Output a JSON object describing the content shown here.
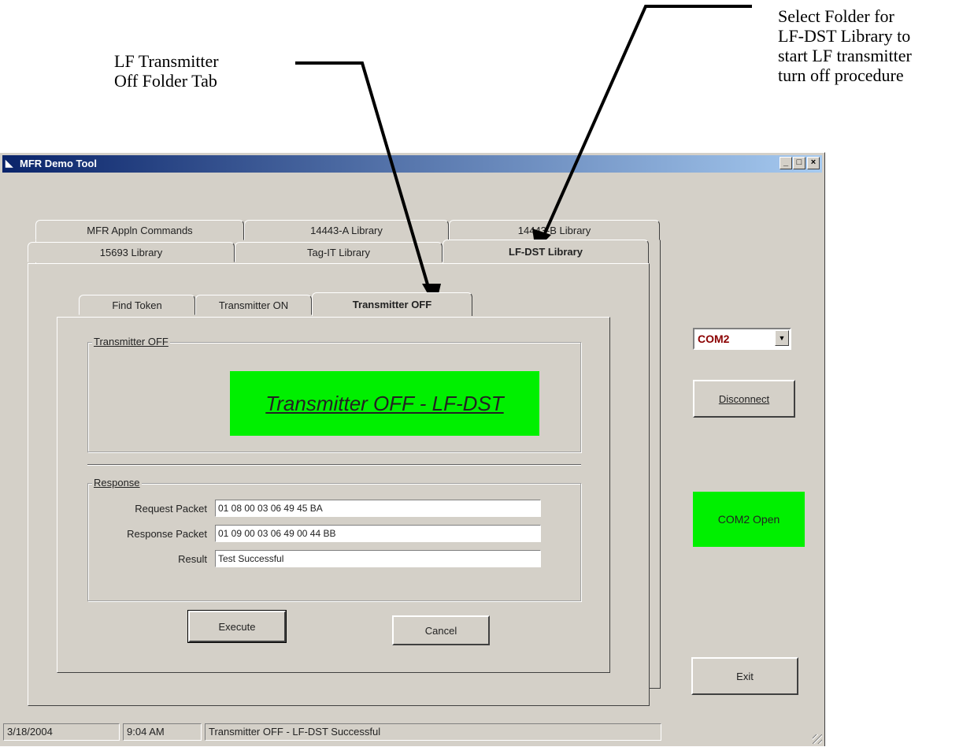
{
  "annotations": {
    "left": [
      "LF Transmitter",
      "Off Folder Tab"
    ],
    "right": [
      "Select Folder for",
      "LF-DST Library to",
      "start LF transmitter",
      "turn off procedure"
    ]
  },
  "window": {
    "title": "MFR Demo Tool",
    "buttons": {
      "minimize": "_",
      "maximize": "□",
      "close": "×"
    }
  },
  "tabs_row1": [
    "MFR Appln Commands",
    "14443-A Library",
    "14443-B Library"
  ],
  "tabs_row2": [
    "15693 Library",
    "Tag-IT Library",
    "LF-DST Library"
  ],
  "subtabs": [
    "Find Token",
    "Transmitter ON",
    "Transmitter OFF"
  ],
  "transmitter_group": {
    "label": "Transmitter OFF",
    "banner": "Transmitter OFF - LF-DST"
  },
  "response_group": {
    "label": "Response",
    "request_label": "Request Packet",
    "request_value": "01 08 00 03 06 49 45 BA",
    "response_label": "Response Packet",
    "response_value": "01 09 00 03 06 49 00 44 BB",
    "result_label": "Result",
    "result_value": "Test Successful"
  },
  "buttons": {
    "execute": "Execute",
    "cancel": "Cancel"
  },
  "side": {
    "port_selected": "COM2",
    "disconnect": "Disconnect",
    "status": "COM2 Open",
    "exit": "Exit"
  },
  "statusbar": {
    "date": "3/18/2004",
    "time": "9:04 AM",
    "message": "Transmitter OFF - LF-DST Successful"
  }
}
